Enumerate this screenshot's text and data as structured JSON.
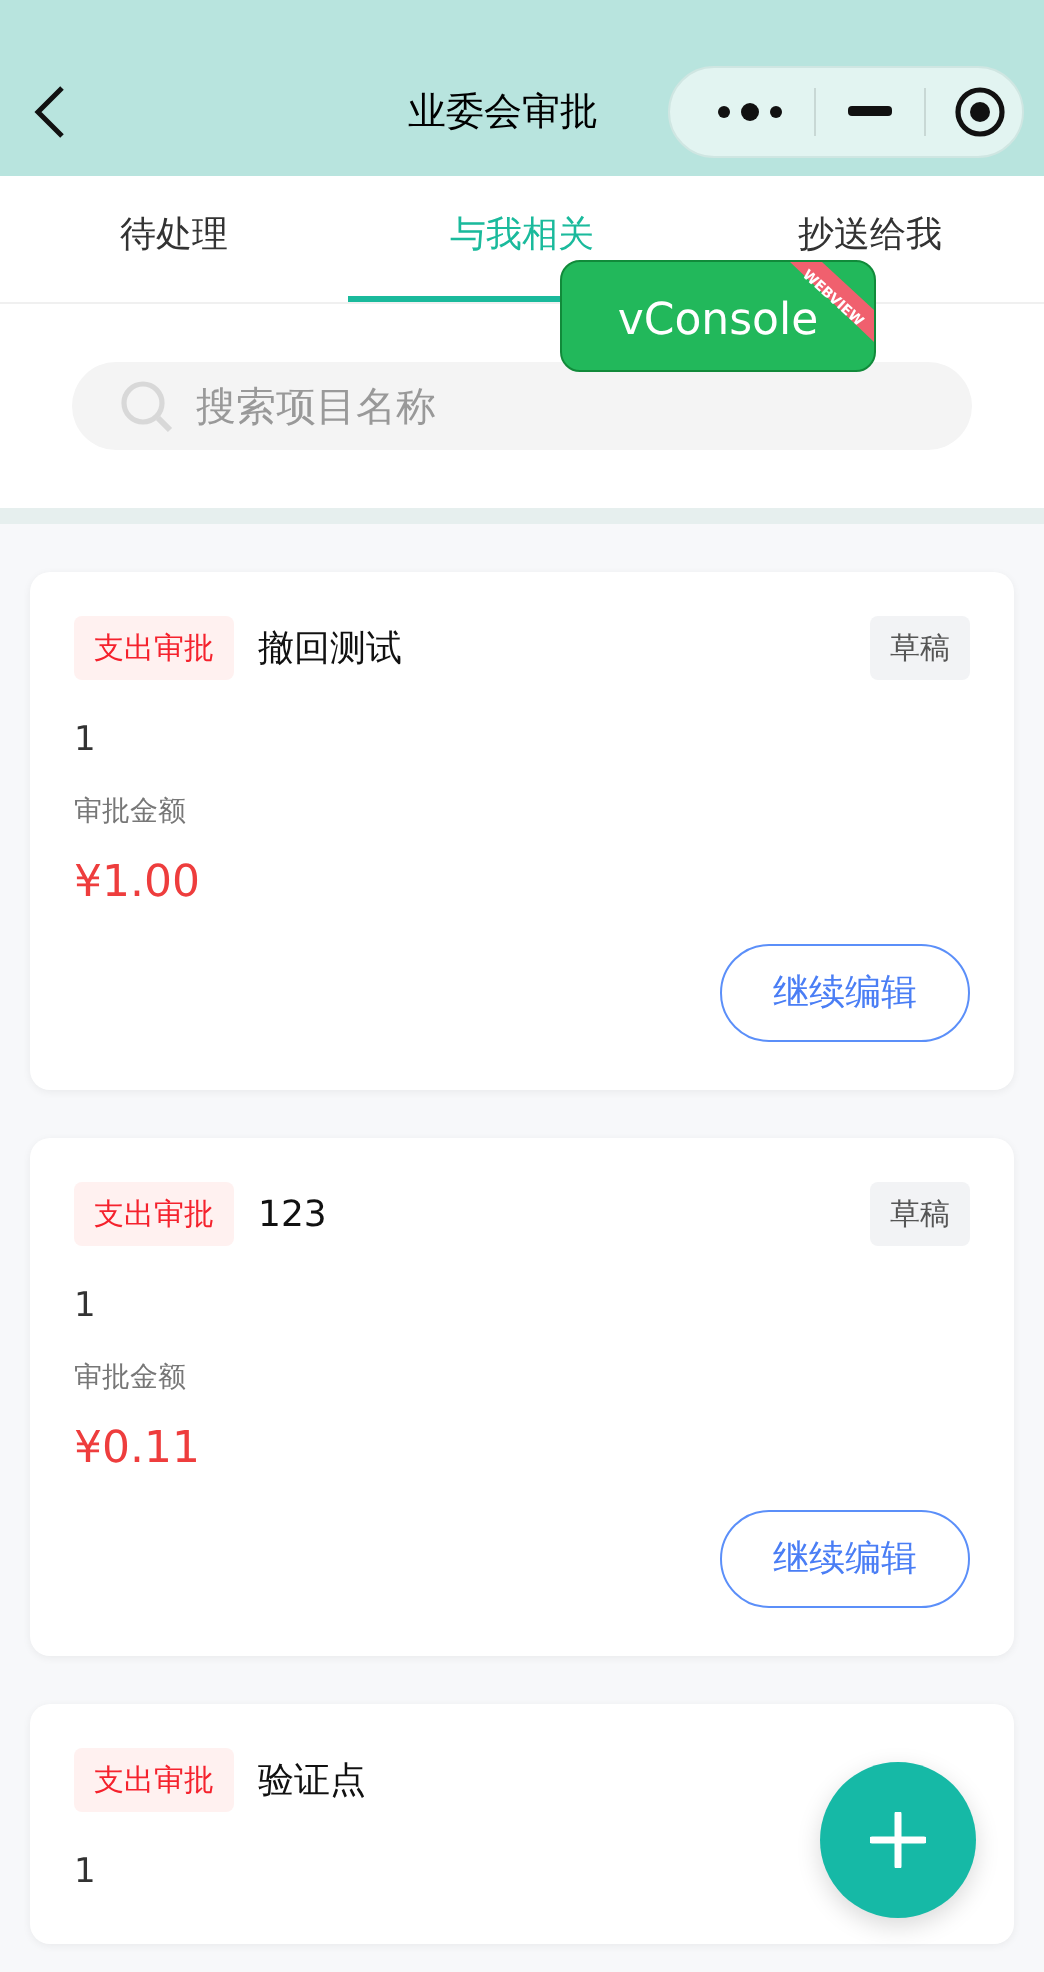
{
  "header": {
    "title": "业委会审批"
  },
  "tabs": [
    {
      "label": "待处理",
      "selected": false
    },
    {
      "label": "与我相关",
      "selected": true
    },
    {
      "label": "抄送给我",
      "selected": false
    }
  ],
  "search": {
    "placeholder": "搜索项目名称"
  },
  "vconsole": {
    "label": "vConsole",
    "ribbon": "WEBVIEW"
  },
  "cards": [
    {
      "tag": "支出审批",
      "title": "撤回测试",
      "status": "草稿",
      "number": "1",
      "amount_label": "审批金额",
      "amount": "¥1.00",
      "action": "继续编辑"
    },
    {
      "tag": "支出审批",
      "title": "123",
      "status": "草稿",
      "number": "1",
      "amount_label": "审批金额",
      "amount": "¥0.11",
      "action": "继续编辑"
    },
    {
      "tag": "支出审批",
      "title": "验证点",
      "number": "1"
    }
  ]
}
